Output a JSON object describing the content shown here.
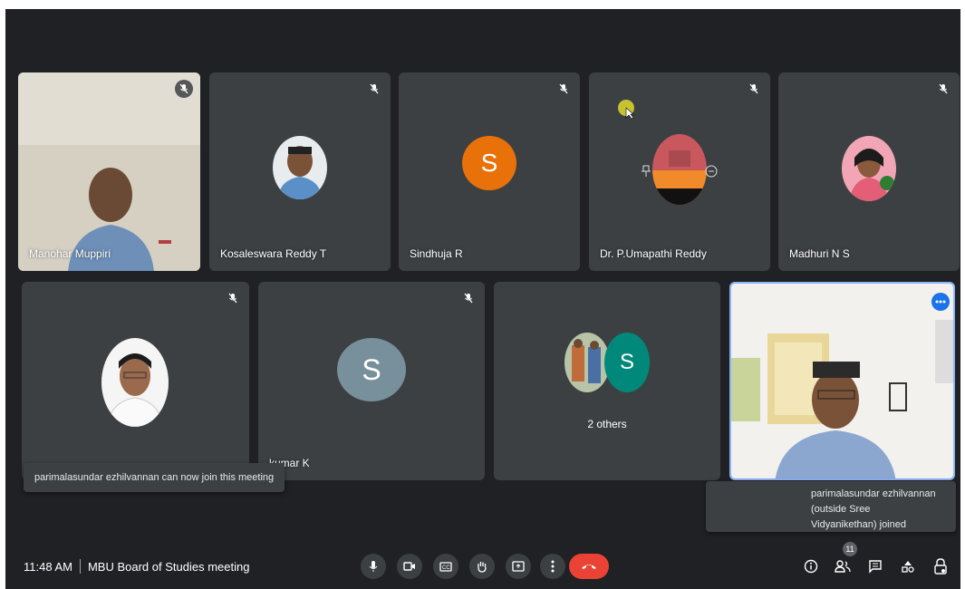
{
  "meeting": {
    "time": "11:48 AM",
    "title": "MBU Board of Studies meeting",
    "participant_count": "11"
  },
  "tiles": [
    {
      "name": "Manohar Muppiri"
    },
    {
      "name": "Kosaleswara Reddy T"
    },
    {
      "name": "Sindhuja R",
      "initial": "S"
    },
    {
      "name": "Dr. P.Umapathi Reddy"
    },
    {
      "name": "Madhuri N S"
    },
    {
      "name": ""
    },
    {
      "name": "kumar K",
      "initial": "S"
    },
    {
      "name": "",
      "initial": "S",
      "others_label": "2 others"
    },
    {
      "name": ""
    }
  ],
  "toasts": {
    "join_notice": "parimalasundar ezhilvannan can now join this meeting",
    "hand_line1": "parimalasundar ezhilvannan",
    "hand_line2": "(outside Sree",
    "hand_line3": "Vidyanikethan) joined"
  },
  "controls": [
    "mic-icon",
    "camera-icon",
    "captions-icon",
    "raise-hand-icon",
    "present-icon",
    "more-options-icon",
    "end-call-icon"
  ],
  "right_icons": [
    "info-icon",
    "people-icon",
    "chat-icon",
    "activities-icon",
    "host-controls-icon"
  ],
  "colors": {
    "background": "#202124",
    "tile": "#3c4043",
    "end_call": "#ea4335",
    "active_border": "#8ab4f8",
    "sindhuja_avatar": "#e8710a",
    "s_avatar_grey": "#78909c",
    "s_avatar_teal": "#00897b"
  }
}
